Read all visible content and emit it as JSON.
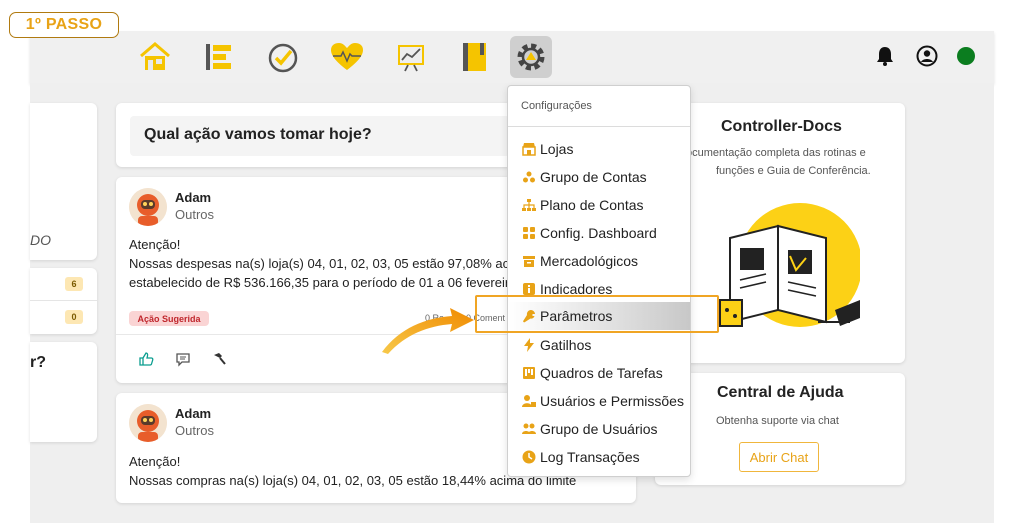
{
  "step_badge": "1º PASSO",
  "nav": {
    "items": [
      {
        "name": "home-icon"
      },
      {
        "name": "list-icon"
      },
      {
        "name": "check-circle-icon"
      },
      {
        "name": "heart-pulse-icon"
      },
      {
        "name": "chart-icon"
      },
      {
        "name": "notebook-icon"
      },
      {
        "name": "gear-icon",
        "active": true
      }
    ],
    "right": [
      "bell-icon",
      "user-circle-icon",
      "status-dot"
    ],
    "accent_color": "#f5c400",
    "status_color": "#0b7d1f"
  },
  "left_panel": {
    "partial_label": "DO",
    "counts": [
      "6",
      "0"
    ],
    "partial_question": "r?"
  },
  "feed": {
    "question": "Qual ação vamos tomar hoje?",
    "posts": [
      {
        "author": "Adam",
        "category": "Outros",
        "line1": "Atenção!",
        "line2": "Nossas despesas na(s) loja(s) 04, 01, 02, 03, 05 estão 97,08% acima",
        "line3": "estabelecido de R$ 536.166,35 para o período de 01 a 06 fevereiro",
        "badge": "Ação Sugerida",
        "meta_reactions": "0 Re",
        "meta_comments": "0 Coment"
      },
      {
        "author": "Adam",
        "category": "Outros",
        "line1": "Atenção!",
        "line2": "Nossas compras na(s) loja(s) 04, 01, 02, 03, 05 estão 18,44% acima do limite"
      }
    ]
  },
  "menu": {
    "header": "Configurações",
    "items": [
      {
        "label": "Lojas",
        "icon": "store-icon"
      },
      {
        "label": "Grupo de Contas",
        "icon": "account-group-icon"
      },
      {
        "label": "Plano de Contas",
        "icon": "sitemap-icon"
      },
      {
        "label": "Config. Dashboard",
        "icon": "dashboard-icon"
      },
      {
        "label": "Mercadológicos",
        "icon": "archive-icon"
      },
      {
        "label": "Indicadores",
        "icon": "indicator-icon"
      },
      {
        "label": "Parâmetros",
        "icon": "wrench-icon",
        "highlighted": true
      },
      {
        "label": "Gatilhos",
        "icon": "bolt-icon"
      },
      {
        "label": "Quadros de Tarefas",
        "icon": "kanban-icon"
      },
      {
        "label": "Usuários e Permissões",
        "icon": "user-lock-icon"
      },
      {
        "label": "Grupo de Usuários",
        "icon": "users-icon"
      },
      {
        "label": "Log Transações",
        "icon": "clock-icon"
      }
    ]
  },
  "docs_card": {
    "title": "Controller-Docs",
    "line1": "ocumentação completa das rotinas e",
    "line2": "funções e Guia de Conferência."
  },
  "help_card": {
    "title": "Central de Ajuda",
    "text": "Obtenha suporte via chat",
    "button": "Abrir Chat"
  }
}
